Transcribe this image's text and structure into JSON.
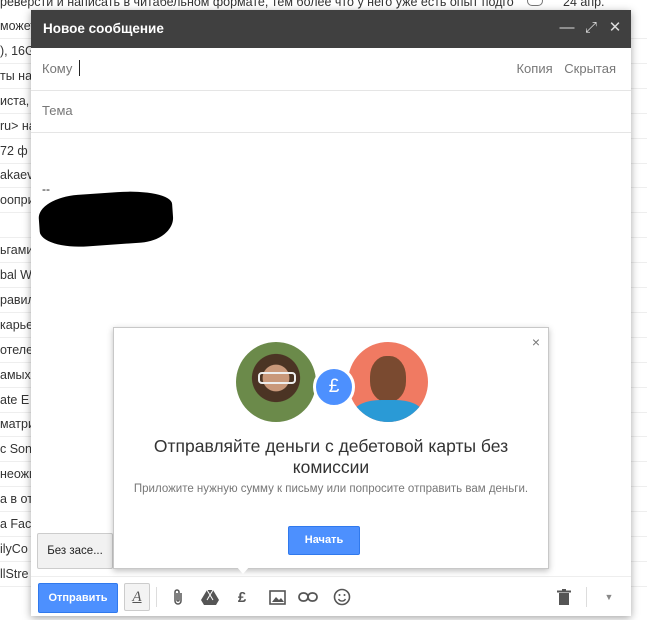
{
  "background_inbox": {
    "top_row": {
      "text": "реверсти и написать в читабельном формате, тем более что у него уже есть опыт подго",
      "date": "24 апр."
    },
    "rows": [
      "можеть",
      "), 16G",
      "ты наз",
      "иста, с",
      "ru> на",
      "72 ф",
      "akaev",
      "оопри",
      "",
      "ьгами",
      "bal W",
      "равила",
      "карье",
      "отеле",
      "амых",
      "ate E",
      "матри",
      "c Son",
      "неожи",
      "а в от",
      "a Fac",
      "ilyCo",
      "llStre"
    ]
  },
  "compose": {
    "title": "Новое сообщение",
    "to_label": "Кому",
    "cc_label": "Копия",
    "bcc_label": "Скрытая",
    "subject_placeholder": "Тема",
    "signature_dash": "--",
    "save_chip": "Без засе...",
    "send_label": "Отправить",
    "window_controls": [
      "minimize-icon",
      "expand-icon",
      "close-icon"
    ],
    "toolbar_icons": [
      "format-text-icon",
      "attach-icon",
      "drive-icon",
      "pound-money-icon",
      "photo-icon",
      "link-icon",
      "emoji-icon",
      "trash-icon",
      "more-options-icon"
    ]
  },
  "promo": {
    "title": "Отправляйте деньги с дебетовой карты без комиссии",
    "subtitle": "Приложите нужную сумму к письму или попросите отправить вам деньги.",
    "button": "Начать",
    "close": "×",
    "currency_symbol": "£",
    "accent_color": "#4d90fe"
  }
}
